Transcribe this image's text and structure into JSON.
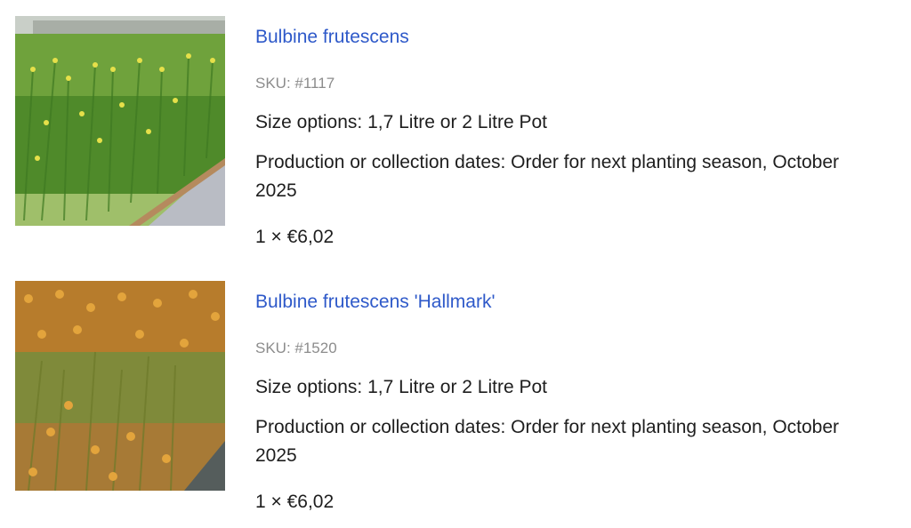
{
  "items": [
    {
      "image_desc": "green grassy bulbine plants with yellow flowers",
      "name": "Bulbine frutescens",
      "sku": "SKU: #1117",
      "size_options": "Size options: 1,7 Litre or 2 Litre Pot",
      "dates": "Production or collection dates: Order for next planting season, October 2025",
      "price": "1 × €6,02"
    },
    {
      "image_desc": "bulbine plants with orange flowers",
      "name": "Bulbine frutescens 'Hallmark'",
      "sku": "SKU: #1520",
      "size_options": "Size options: 1,7 Litre or 2 Litre Pot",
      "dates": "Production or collection dates: Order for next planting season, October 2025",
      "price": "1 × €6,02"
    }
  ],
  "colors": {
    "link": "#2e59c9",
    "sku": "#8c8c8c",
    "text": "#1e1e1e"
  }
}
